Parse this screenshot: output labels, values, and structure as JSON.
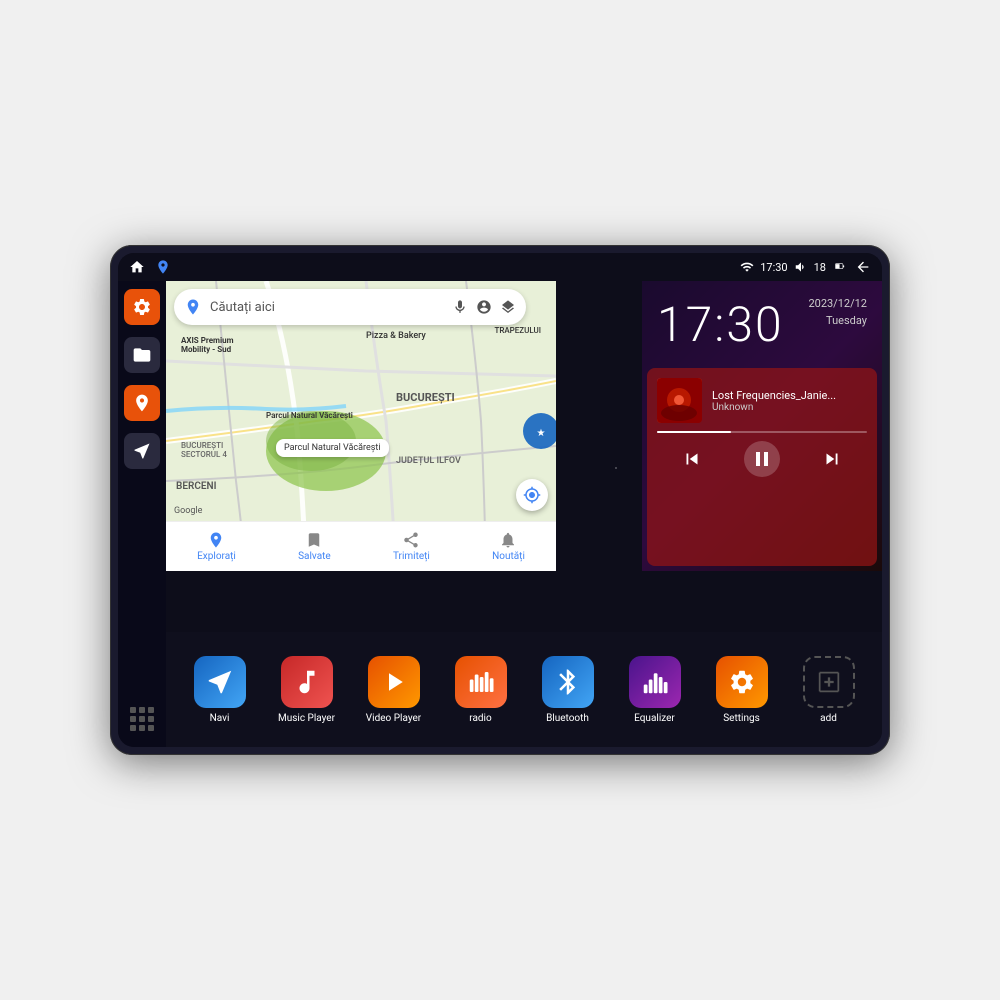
{
  "device": {
    "status_bar": {
      "left_icons": [
        "home",
        "maps"
      ],
      "time": "17:30",
      "signal": "wifi",
      "volume": "speaker",
      "battery": "18",
      "back": "back-arrow"
    },
    "date": {
      "date_str": "2023/12/12",
      "day": "Tuesday"
    },
    "clock": {
      "time": "17:30"
    },
    "music": {
      "track": "Lost Frequencies_Janie...",
      "artist": "Unknown",
      "progress": 35
    },
    "map": {
      "search_placeholder": "Căutați aici",
      "labels": [
        "AXIS Premium Mobility - Sud",
        "Pizza & Bakery",
        "TRAPEZULUI",
        "Parcul Natural Văcărești",
        "BUCUREȘTI",
        "BUCUREȘTI SECTORUL 4",
        "BERCENI",
        "JUDEȚUL ILFOV"
      ],
      "bottom_items": [
        "Explorați",
        "Salvate",
        "Trimiteți",
        "Noutăți"
      ]
    },
    "apps": [
      {
        "id": "navi",
        "label": "Navi",
        "icon_color": "navi"
      },
      {
        "id": "music-player",
        "label": "Music Player",
        "icon_color": "music"
      },
      {
        "id": "video-player",
        "label": "Video Player",
        "icon_color": "video"
      },
      {
        "id": "radio",
        "label": "radio",
        "icon_color": "radio"
      },
      {
        "id": "bluetooth",
        "label": "Bluetooth",
        "icon_color": "bluetooth"
      },
      {
        "id": "equalizer",
        "label": "Equalizer",
        "icon_color": "equalizer"
      },
      {
        "id": "settings",
        "label": "Settings",
        "icon_color": "settings"
      },
      {
        "id": "add",
        "label": "add",
        "icon_color": "add-icon"
      }
    ],
    "sidebar": [
      {
        "id": "settings",
        "type": "orange"
      },
      {
        "id": "files",
        "type": "dark"
      },
      {
        "id": "maps",
        "type": "orange"
      },
      {
        "id": "navigation",
        "type": "dark"
      }
    ]
  }
}
